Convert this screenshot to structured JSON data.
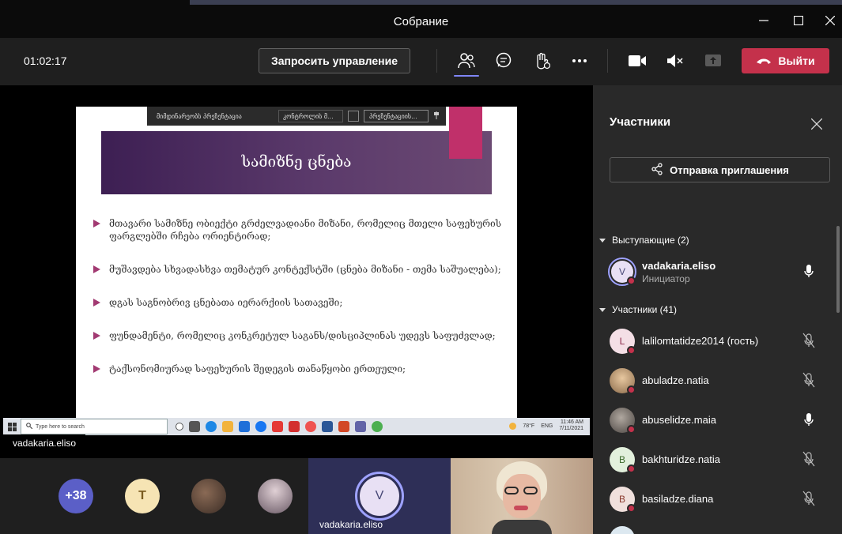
{
  "window": {
    "title": "Собрание"
  },
  "toolbar": {
    "timer": "01:02:17",
    "request_control_label": "Запросить управление",
    "leave_label": "Выйти"
  },
  "slide": {
    "toolbar_label": "მიმდინარეობს პრეზენტაცია",
    "control_select": "კონტროლის მ...",
    "stop_button": "პრეზენტაციის...",
    "title": "სამიზნე ცნება",
    "bullets": [
      "მთავარი სამიზნე ობიექტი გრძელვადიანი მიზანი, რომელიც მთელი საფეხურის ფარგლებში რჩება ორიენტირად;",
      "მუშავდება სხვადასხვა თემატურ კონტექსტში (ცნება მიზანი - თემა საშუალება);",
      "დგას საგნობრივ ცნებათა იერარქიის სათავეში;",
      "ფუნდამენტი, რომელიც კონკრეტულ საგანს/დისციპლინას უდევს საფუძვლად;",
      "ტაქსონომიურად საფეხურის შედეგის თანაწყობი ერთეული;"
    ],
    "taskbar_search": "Type here to search",
    "weather": "78°F",
    "lang": "ENG",
    "clock_time": "11:46 AM",
    "clock_date": "7/11/2021"
  },
  "stage": {
    "presenter_name": "vadakaria.eliso"
  },
  "strip": {
    "more_count": "+38",
    "t_initial": "T",
    "active_speaker_initial": "V",
    "active_speaker_name": "vadakaria.eliso"
  },
  "panel": {
    "title": "Участники",
    "invite_label": "Отправка приглашения",
    "presenters_header": "Выступающие (2)",
    "attendees_header": "Участники (41)",
    "presenters": [
      {
        "initial": "V",
        "name": "vadakaria.eliso",
        "role": "Инициатор"
      }
    ],
    "attendees": [
      {
        "initial": "L",
        "name": "lalilomtatidze2014 (гость)"
      },
      {
        "initial": "",
        "name": "abuladze.natia"
      },
      {
        "initial": "",
        "name": "abuselidze.maia"
      },
      {
        "initial": "B",
        "name": "bakhturidze.natia"
      },
      {
        "initial": "B",
        "name": "basiladze.diana"
      }
    ]
  },
  "colors": {
    "accent": "#7f85f5",
    "leave": "#c4314b",
    "slide_header": "#4a2a5e",
    "slide_accent": "#c0306a"
  }
}
